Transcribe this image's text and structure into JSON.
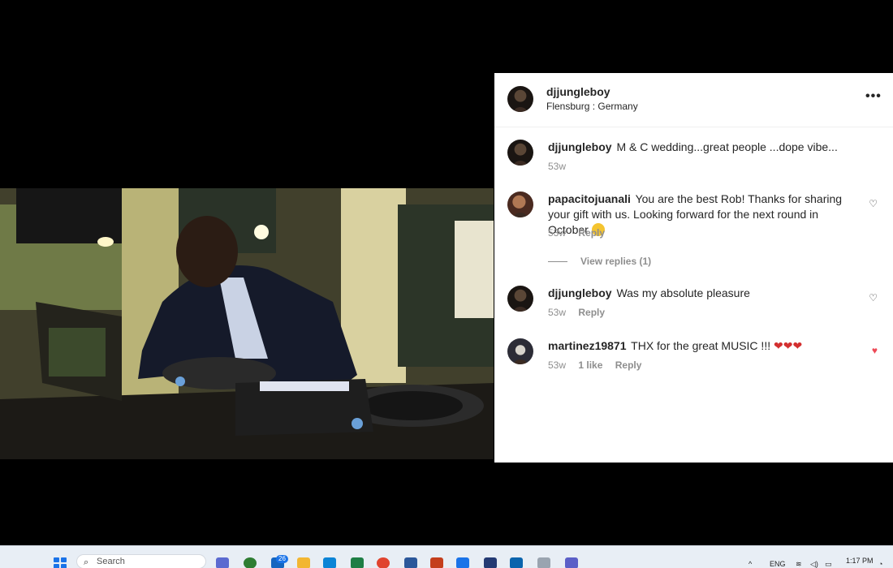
{
  "post": {
    "username": "djjungleboy",
    "location": "Flensburg : Germany",
    "more_label": "•••"
  },
  "comments": [
    {
      "username": "djjungleboy",
      "text": "M & C wedding...great people ...dope vibe...",
      "time": "53w"
    },
    {
      "username": "papacitojuanali",
      "text": "You are the best Rob! Thanks for sharing your gift with us. Looking forward for the next round in October",
      "time": "53w",
      "reply": "Reply",
      "view_replies": "View replies (1)"
    },
    {
      "username": "djjungleboy",
      "text": "Was my absolute pleasure",
      "time": "53w",
      "reply": "Reply"
    },
    {
      "username": "martinez19871",
      "text": "THX for the great MUSIC !!!",
      "time": "53w",
      "likes": "1 like",
      "reply": "Reply"
    }
  ],
  "taskbar": {
    "search_placeholder": "Search",
    "badge_count": "26",
    "lang": "ENG",
    "time": "1:17 PM"
  },
  "colors": {
    "liked_heart": "#ed4956",
    "muted_text": "#8e8e8e"
  }
}
